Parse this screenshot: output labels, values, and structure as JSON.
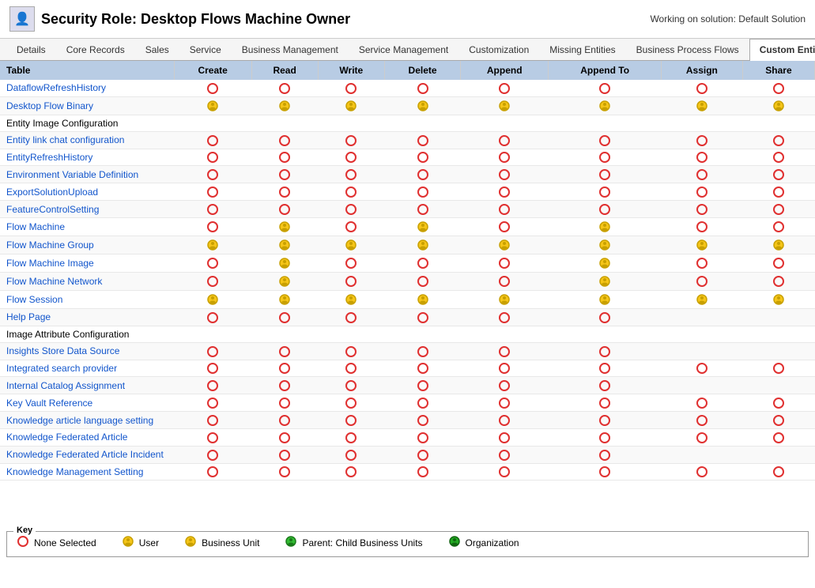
{
  "header": {
    "title": "Security Role: Desktop Flows Machine Owner",
    "working_on": "Working on solution: Default Solution",
    "icon": "👤"
  },
  "tabs": [
    {
      "label": "Details",
      "active": false
    },
    {
      "label": "Core Records",
      "active": false
    },
    {
      "label": "Sales",
      "active": false
    },
    {
      "label": "Service",
      "active": false
    },
    {
      "label": "Business Management",
      "active": false
    },
    {
      "label": "Service Management",
      "active": false
    },
    {
      "label": "Customization",
      "active": false
    },
    {
      "label": "Missing Entities",
      "active": false
    },
    {
      "label": "Business Process Flows",
      "active": false
    },
    {
      "label": "Custom Entities",
      "active": true
    }
  ],
  "table": {
    "columns": [
      "Table",
      "Create",
      "Read",
      "Write",
      "Delete",
      "Append",
      "Append To",
      "Assign",
      "Share"
    ],
    "rows": [
      {
        "name": "DataflowRefreshHistory",
        "link": true,
        "create": "none",
        "read": "none",
        "write": "none",
        "delete": "none",
        "append": "none",
        "appendTo": "none",
        "assign": "none",
        "share": "none"
      },
      {
        "name": "Desktop Flow Binary",
        "link": true,
        "create": "user",
        "read": "user",
        "write": "user",
        "delete": "user",
        "append": "user",
        "appendTo": "user",
        "assign": "user",
        "share": "user"
      },
      {
        "name": "Entity Image Configuration",
        "link": false,
        "create": "",
        "read": "",
        "write": "",
        "delete": "",
        "append": "",
        "appendTo": "",
        "assign": "",
        "share": ""
      },
      {
        "name": "Entity link chat configuration",
        "link": true,
        "create": "none",
        "read": "none",
        "write": "none",
        "delete": "none",
        "append": "none",
        "appendTo": "none",
        "assign": "none",
        "share": "none"
      },
      {
        "name": "EntityRefreshHistory",
        "link": true,
        "create": "none",
        "read": "none",
        "write": "none",
        "delete": "none",
        "append": "none",
        "appendTo": "none",
        "assign": "none",
        "share": "none"
      },
      {
        "name": "Environment Variable Definition",
        "link": true,
        "create": "none",
        "read": "none",
        "write": "none",
        "delete": "none",
        "append": "none",
        "appendTo": "none",
        "assign": "none",
        "share": "none"
      },
      {
        "name": "ExportSolutionUpload",
        "link": true,
        "create": "none",
        "read": "none",
        "write": "none",
        "delete": "none",
        "append": "none",
        "appendTo": "none",
        "assign": "none",
        "share": "none"
      },
      {
        "name": "FeatureControlSetting",
        "link": true,
        "create": "none",
        "read": "none",
        "write": "none",
        "delete": "none",
        "append": "none",
        "appendTo": "none",
        "assign": "none",
        "share": "none"
      },
      {
        "name": "Flow Machine",
        "link": true,
        "create": "none",
        "read": "user",
        "write": "none",
        "delete": "user",
        "append": "none",
        "appendTo": "user",
        "assign": "none",
        "share": "none"
      },
      {
        "name": "Flow Machine Group",
        "link": true,
        "create": "user",
        "read": "user",
        "write": "user",
        "delete": "user",
        "append": "user",
        "appendTo": "user",
        "assign": "user",
        "share": "user"
      },
      {
        "name": "Flow Machine Image",
        "link": true,
        "create": "none",
        "read": "user",
        "write": "none",
        "delete": "none",
        "append": "none",
        "appendTo": "user",
        "assign": "none",
        "share": "none"
      },
      {
        "name": "Flow Machine Network",
        "link": true,
        "create": "none",
        "read": "user",
        "write": "none",
        "delete": "none",
        "append": "none",
        "appendTo": "user",
        "assign": "none",
        "share": "none"
      },
      {
        "name": "Flow Session",
        "link": true,
        "create": "user",
        "read": "user",
        "write": "user",
        "delete": "user",
        "append": "user",
        "appendTo": "user",
        "assign": "user",
        "share": "user"
      },
      {
        "name": "Help Page",
        "link": true,
        "create": "none",
        "read": "none",
        "write": "none",
        "delete": "none",
        "append": "none",
        "appendTo": "none",
        "assign": "",
        "share": ""
      },
      {
        "name": "Image Attribute Configuration",
        "link": false,
        "create": "",
        "read": "",
        "write": "",
        "delete": "",
        "append": "",
        "appendTo": "",
        "assign": "",
        "share": ""
      },
      {
        "name": "Insights Store Data Source",
        "link": true,
        "create": "none",
        "read": "none",
        "write": "none",
        "delete": "none",
        "append": "none",
        "appendTo": "none",
        "assign": "",
        "share": ""
      },
      {
        "name": "Integrated search provider",
        "link": true,
        "create": "none",
        "read": "none",
        "write": "none",
        "delete": "none",
        "append": "none",
        "appendTo": "none",
        "assign": "none",
        "share": "none"
      },
      {
        "name": "Internal Catalog Assignment",
        "link": true,
        "create": "none",
        "read": "none",
        "write": "none",
        "delete": "none",
        "append": "none",
        "appendTo": "none",
        "assign": "",
        "share": ""
      },
      {
        "name": "Key Vault Reference",
        "link": true,
        "create": "none",
        "read": "none",
        "write": "none",
        "delete": "none",
        "append": "none",
        "appendTo": "none",
        "assign": "none",
        "share": "none"
      },
      {
        "name": "Knowledge article language setting",
        "link": true,
        "create": "none",
        "read": "none",
        "write": "none",
        "delete": "none",
        "append": "none",
        "appendTo": "none",
        "assign": "none",
        "share": "none"
      },
      {
        "name": "Knowledge Federated Article",
        "link": true,
        "create": "none",
        "read": "none",
        "write": "none",
        "delete": "none",
        "append": "none",
        "appendTo": "none",
        "assign": "none",
        "share": "none"
      },
      {
        "name": "Knowledge Federated Article Incident",
        "link": true,
        "create": "none",
        "read": "none",
        "write": "none",
        "delete": "none",
        "append": "none",
        "appendTo": "none",
        "assign": "",
        "share": ""
      },
      {
        "name": "Knowledge Management Setting",
        "link": true,
        "create": "none",
        "read": "none",
        "write": "none",
        "delete": "none",
        "append": "none",
        "appendTo": "none",
        "assign": "none",
        "share": "none"
      }
    ]
  },
  "key": {
    "label": "Key",
    "items": [
      {
        "label": "None Selected",
        "type": "none"
      },
      {
        "label": "User",
        "type": "user"
      },
      {
        "label": "Business Unit",
        "type": "bu"
      },
      {
        "label": "Parent: Child Business Units",
        "type": "parent"
      },
      {
        "label": "Organization",
        "type": "org"
      }
    ]
  }
}
